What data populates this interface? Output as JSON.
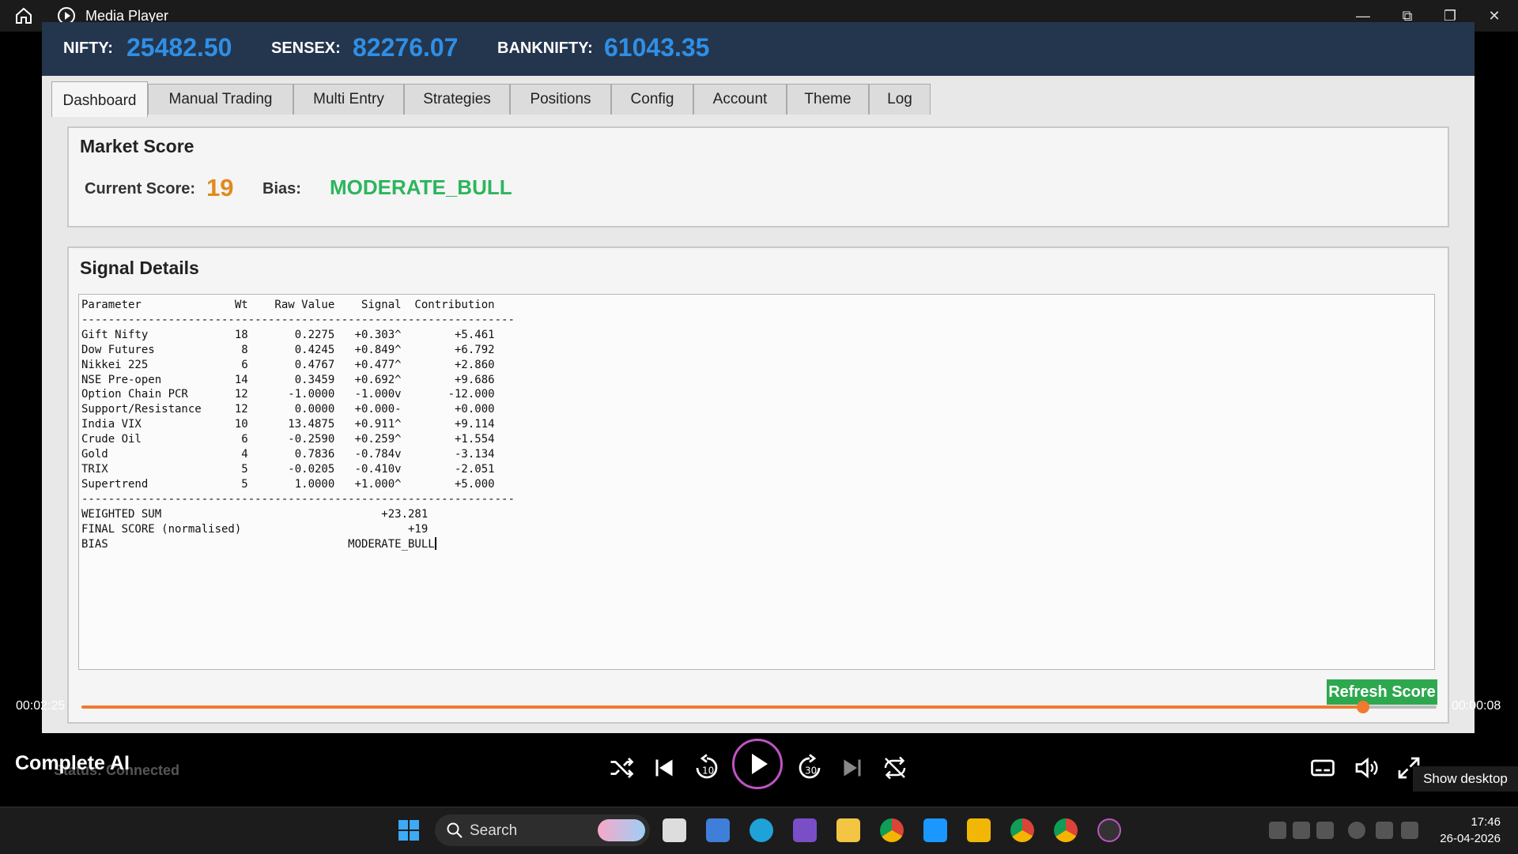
{
  "window": {
    "title": "Media Player"
  },
  "ticker": [
    {
      "label": "NIFTY:",
      "value": "25482.50"
    },
    {
      "label": "SENSEX:",
      "value": "82276.07"
    },
    {
      "label": "BANKNIFTY:",
      "value": "61043.35"
    }
  ],
  "tabs": [
    "Dashboard",
    "Manual Trading",
    "Multi Entry",
    "Strategies",
    "Positions",
    "Config",
    "Account",
    "Theme",
    "Log"
  ],
  "market_score": {
    "title": "Market Score",
    "current_score_label": "Current Score:",
    "current_score": "19",
    "bias_label": "Bias:",
    "bias": "MODERATE_BULL"
  },
  "signal_details": {
    "title": "Signal Details",
    "columns": [
      "Parameter",
      "Wt",
      "Raw Value",
      "Signal",
      "Contribution"
    ],
    "rows": [
      [
        "Gift Nifty",
        "18",
        "0.2275",
        "+0.303^",
        "+5.461"
      ],
      [
        "Dow Futures",
        "8",
        "0.4245",
        "+0.849^",
        "+6.792"
      ],
      [
        "Nikkei 225",
        "6",
        "0.4767",
        "+0.477^",
        "+2.860"
      ],
      [
        "NSE Pre-open",
        "14",
        "0.3459",
        "+0.692^",
        "+9.686"
      ],
      [
        "Option Chain PCR",
        "12",
        "-1.0000",
        "-1.000v",
        "-12.000"
      ],
      [
        "Support/Resistance",
        "12",
        "0.0000",
        "+0.000-",
        "+0.000"
      ],
      [
        "India VIX",
        "10",
        "13.4875",
        "+0.911^",
        "+9.114"
      ],
      [
        "Crude Oil",
        "6",
        "-0.2590",
        "+0.259^",
        "+1.554"
      ],
      [
        "Gold",
        "4",
        "0.7836",
        "-0.784v",
        "-3.134"
      ],
      [
        "TRIX",
        "5",
        "-0.0205",
        "-0.410v",
        "-2.051"
      ],
      [
        "Supertrend",
        "5",
        "1.0000",
        "+1.000^",
        "+5.000"
      ]
    ],
    "summary": [
      [
        "WEIGHTED SUM",
        "+23.281"
      ],
      [
        "FINAL SCORE (normalised)",
        "+19"
      ],
      [
        "BIAS",
        "MODERATE_BULL"
      ]
    ]
  },
  "refresh_button": "Refresh Score",
  "status": "Status: Connected",
  "player": {
    "elapsed": "00:02:25",
    "remaining": "00:00:08",
    "progress": 0.946,
    "overlay_title": "Complete AI",
    "show_desktop": "Show desktop"
  },
  "taskbar": {
    "search_label": "Search",
    "time": "17:46",
    "date": "26-04-2026"
  },
  "colors": {
    "accent": "#f07b2f",
    "ticker_value": "#2f8fe6",
    "bias": "#2db55d",
    "score": "#e08a1e",
    "refresh": "#2ea84f"
  }
}
